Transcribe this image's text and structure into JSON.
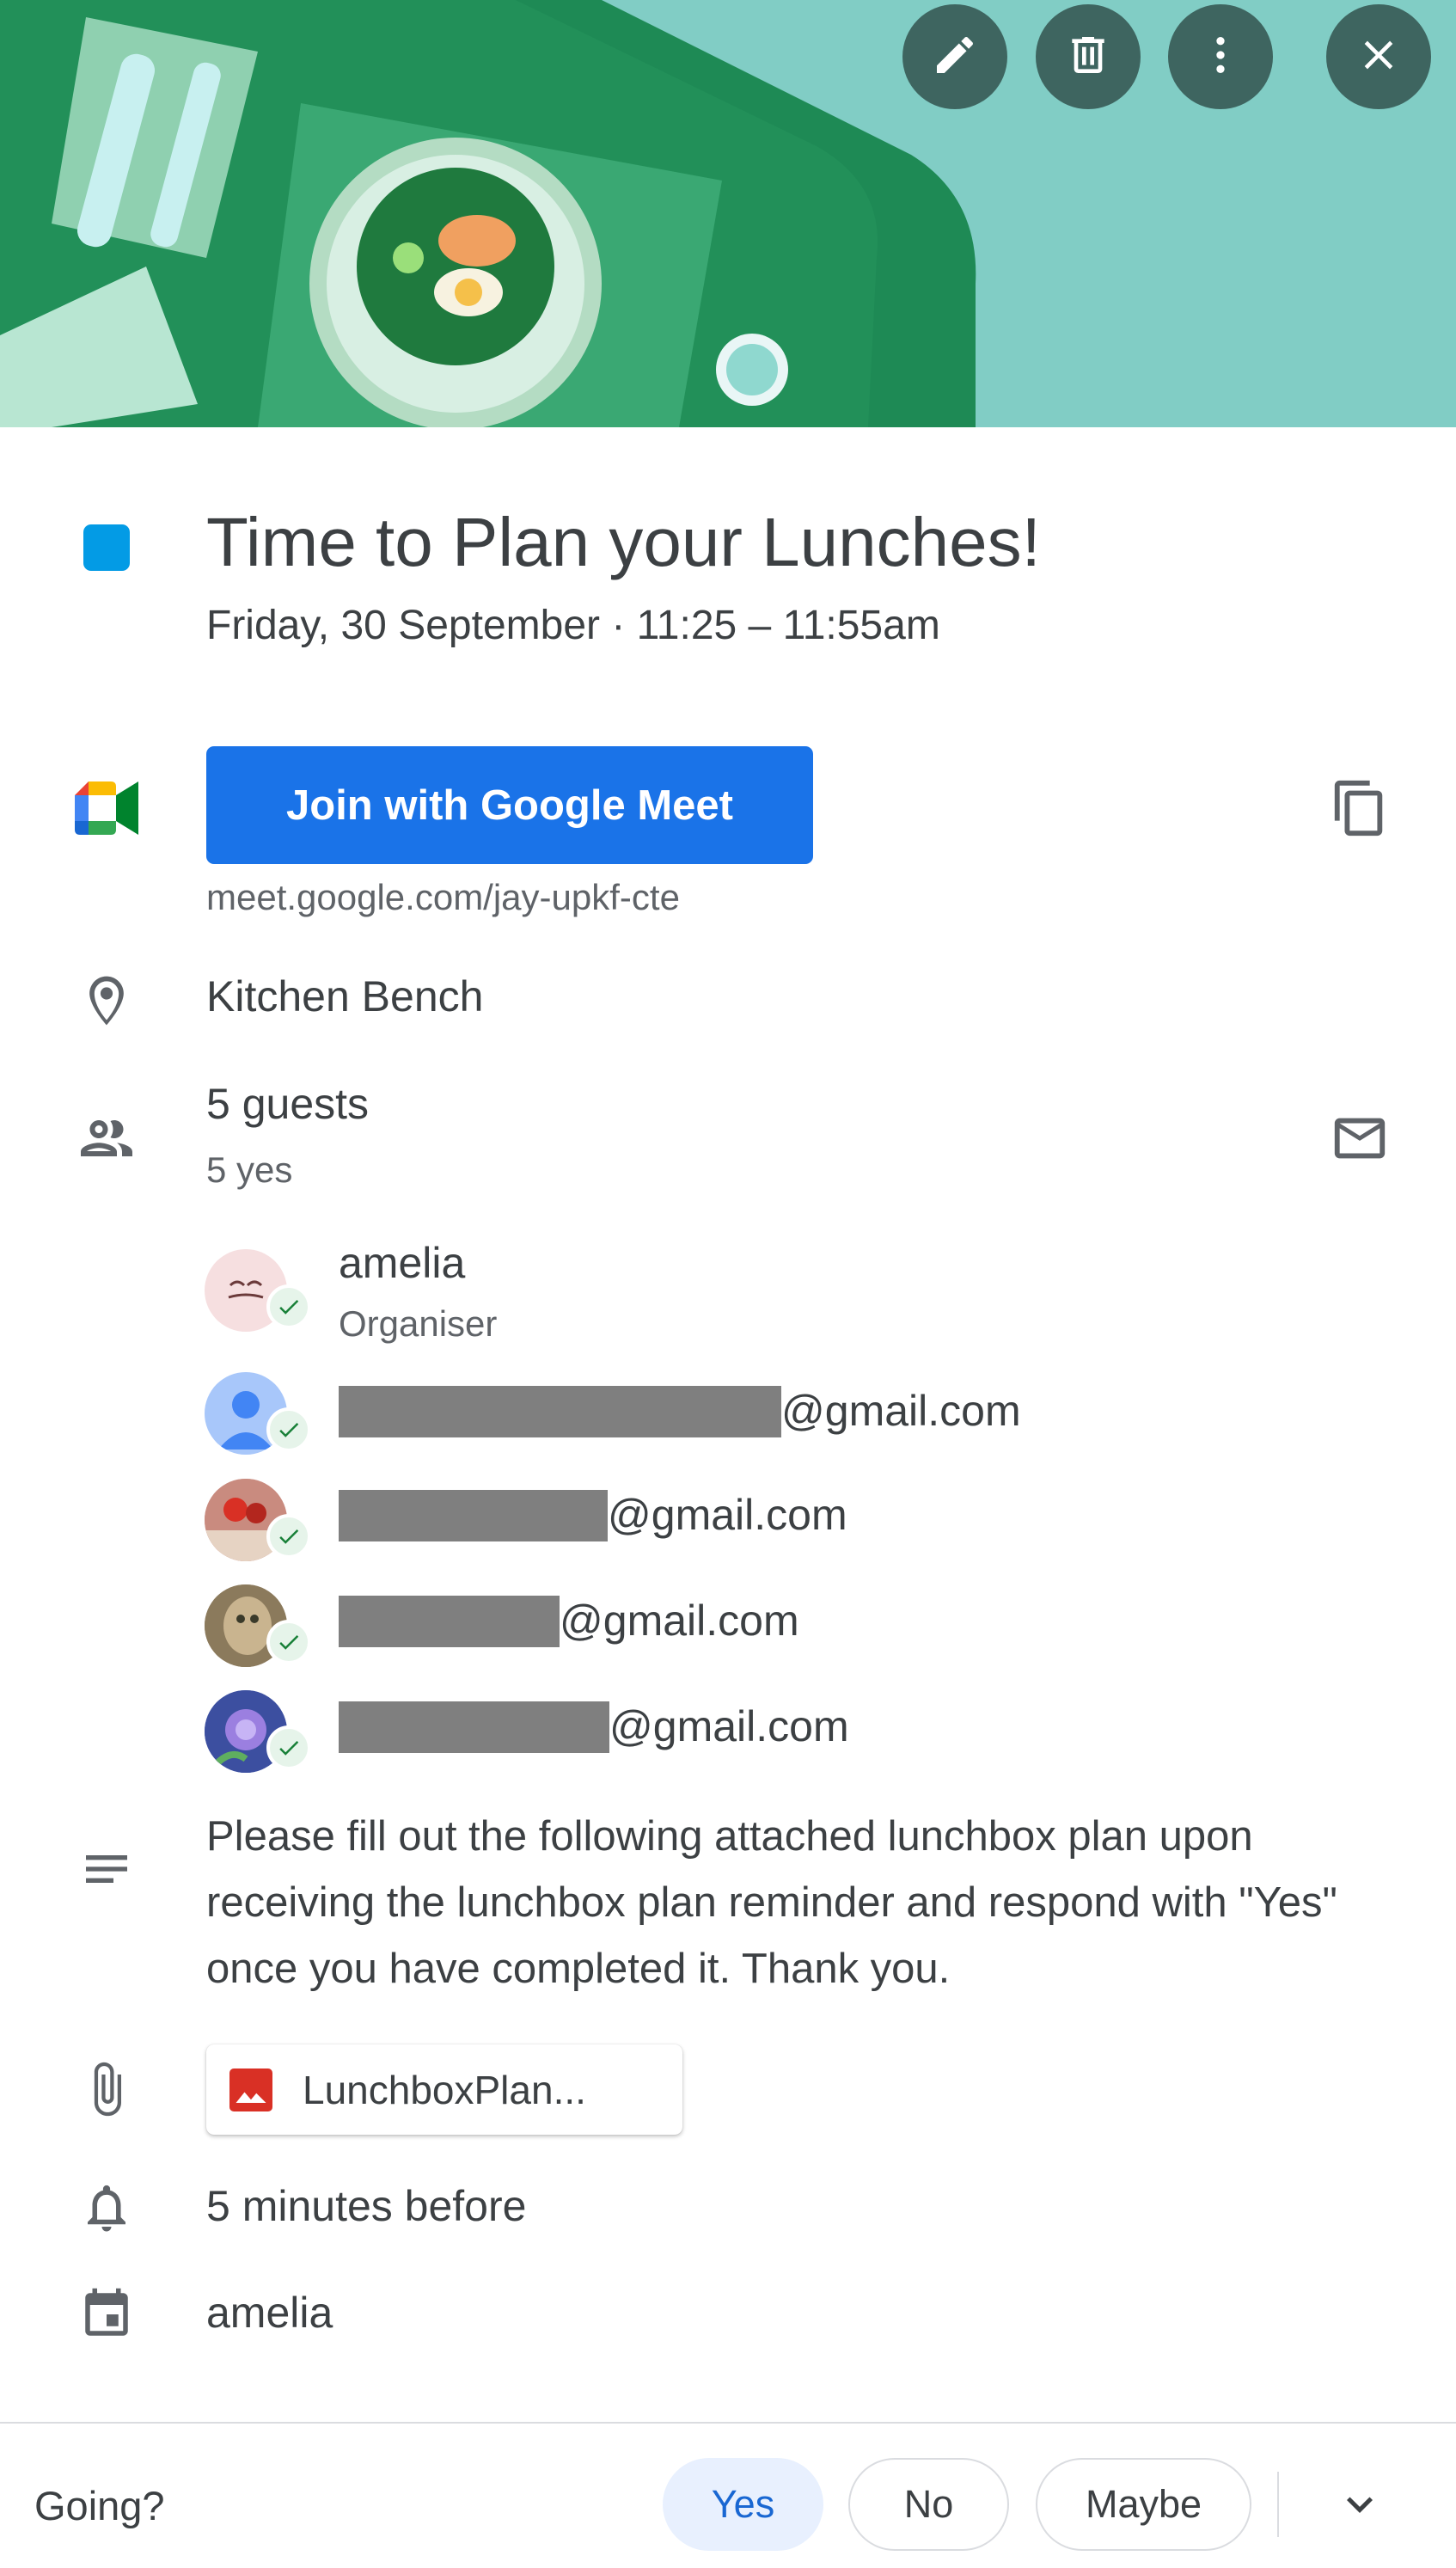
{
  "event": {
    "title": "Time to Plan your Lunches!",
    "date_time": "Friday, 30 September  ·  11:25 – 11:55am",
    "color": "#039be5"
  },
  "header_actions": {
    "edit": "edit-icon",
    "delete": "delete-icon",
    "more": "more-options-icon",
    "close": "close-icon"
  },
  "meet": {
    "button_label": "Join with Google Meet",
    "link": "meet.google.com/jay-upkf-cte"
  },
  "location": "Kitchen Bench",
  "guests": {
    "summary": "5 guests",
    "responses": "5 yes",
    "list": [
      {
        "name": "amelia",
        "role": "Organiser"
      },
      {
        "email_suffix": "@gmail.com"
      },
      {
        "email_suffix": "@gmail.com"
      },
      {
        "email_suffix": "@gmail.com"
      },
      {
        "email_suffix": "@gmail.com"
      }
    ]
  },
  "description": "Please fill out the following attached lunchbox plan upon receiving the lunchbox plan reminder and respond with \"Yes\" once you have completed it. Thank you.",
  "attachment": {
    "name": "LunchboxPlan..."
  },
  "reminder": "5 minutes before",
  "calendar_owner": "amelia",
  "rsvp": {
    "prompt": "Going?",
    "yes": "Yes",
    "no": "No",
    "maybe": "Maybe",
    "selected": "Yes"
  },
  "colors": {
    "meet_button": "#1a73e8",
    "selected_rsvp": "#e8f0fe",
    "header_bg": "#81cdc5"
  }
}
